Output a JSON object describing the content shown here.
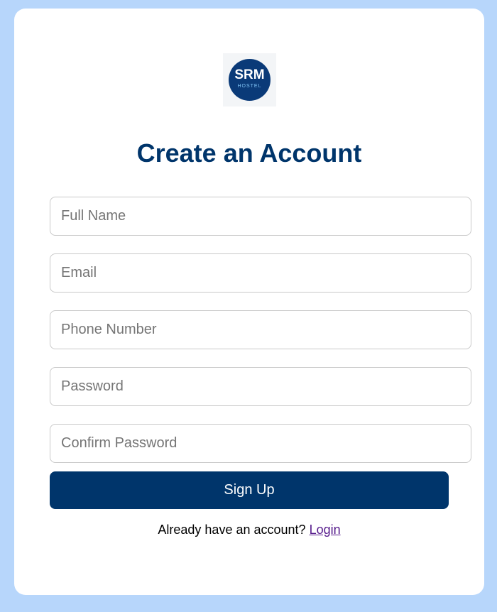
{
  "logo": {
    "main_text": "SRM",
    "sub_text": "HOSTEL"
  },
  "form": {
    "title": "Create an Account",
    "fields": [
      {
        "placeholder": "Full Name",
        "value": ""
      },
      {
        "placeholder": "Email",
        "value": ""
      },
      {
        "placeholder": "Phone Number",
        "value": ""
      },
      {
        "placeholder": "Password",
        "value": ""
      },
      {
        "placeholder": "Confirm Password",
        "value": ""
      }
    ],
    "submit_label": "Sign Up",
    "footer_text": "Already have an account?",
    "login_link": "Login"
  },
  "colors": {
    "page_background": "#b7d6fb",
    "primary": "#00356b",
    "logo_circle": "#0a3a78",
    "link": "#551a8b"
  }
}
